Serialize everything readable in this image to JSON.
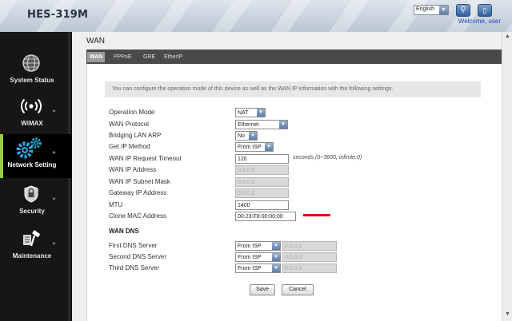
{
  "header": {
    "brand": "HES-319M",
    "language": "English",
    "welcome": "Welcome, user"
  },
  "sidebar": {
    "items": [
      {
        "label": "System Status",
        "icon": "globe-icon"
      },
      {
        "label": "WiMAX",
        "icon": "wireless-signal-icon"
      },
      {
        "label": "Network Setting",
        "icon": "gears-icon",
        "active": true
      },
      {
        "label": "Security",
        "icon": "shield-icon"
      },
      {
        "label": "Maintenance",
        "icon": "hammer-icon"
      }
    ]
  },
  "main": {
    "title": "WAN",
    "tabs": [
      "WAN",
      "PPPoE",
      "GRE",
      "EtherIP"
    ],
    "info": "You can configure the operation mode of this device as well as the WAN IP information with the following settings.",
    "fields": {
      "operation_mode": {
        "label": "Operation Mode",
        "value": "NAT"
      },
      "wan_protocol": {
        "label": "WAN Protocol",
        "value": "Ethernet"
      },
      "bridging_lan_arp": {
        "label": "Bridging LAN ARP",
        "value": "No"
      },
      "get_ip_method": {
        "label": "Get IP Method",
        "value": "From ISP"
      },
      "ip_request_timeout": {
        "label": "WAN IP Request Timeout",
        "value": "120",
        "hint": "seconds (0~3600, infinite:0)"
      },
      "wan_ip": {
        "label": "WAN IP Address",
        "value": "0.0.0.0"
      },
      "subnet_mask": {
        "label": "WAN IP Subnet Mask",
        "value": "0.0.0.0"
      },
      "gateway": {
        "label": "Gateway IP Address",
        "value": "0.0.0.0"
      },
      "mtu": {
        "label": "MTU",
        "value": "1400"
      },
      "clone_mac": {
        "label": "Clone MAC Address",
        "value": "00:23:F8:00:00:00"
      }
    },
    "dns_title": "WAN DNS",
    "dns": [
      {
        "label": "First DNS Server",
        "method": "From ISP",
        "value": "0.0.0.0"
      },
      {
        "label": "Second DNS Server",
        "method": "From ISP",
        "value": "0.0.0.0"
      },
      {
        "label": "Third DNS Server",
        "method": "From ISP",
        "value": "0.0.0.0"
      }
    ],
    "save_label": "Save",
    "cancel_label": "Cancel"
  },
  "colors": {
    "active_accent": "#9acd32",
    "sidebar_bg": "#161616",
    "redaction": "#e0101a"
  }
}
